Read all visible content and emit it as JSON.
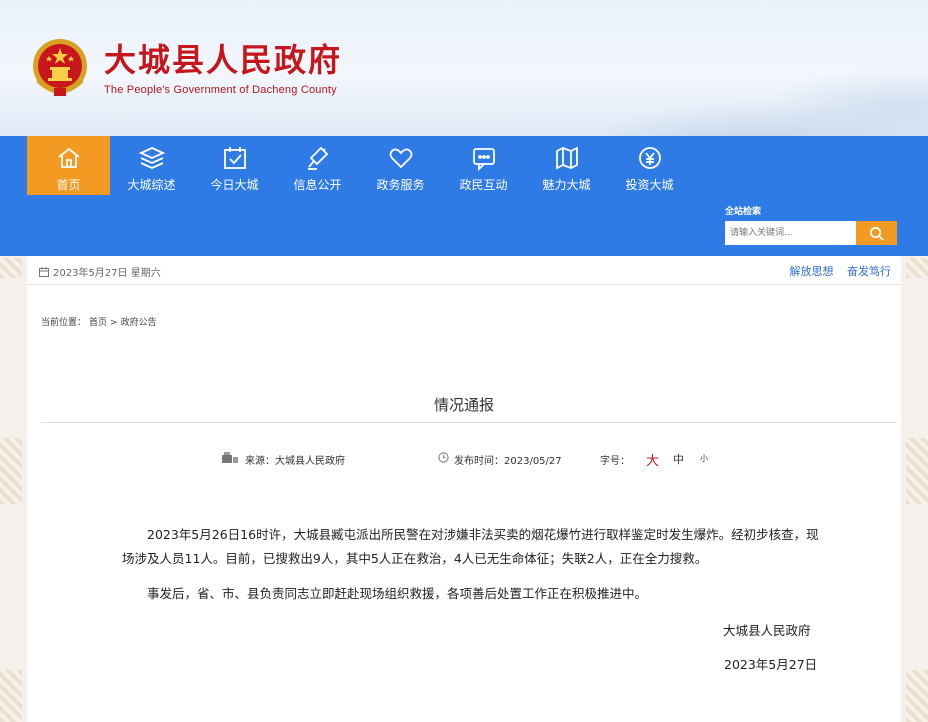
{
  "header": {
    "title": "大城县人民政府",
    "subtitle": "The People's Government of Dacheng County"
  },
  "nav": {
    "items": [
      {
        "label": "首页",
        "icon": "home-icon",
        "active": true
      },
      {
        "label": "大城综述",
        "icon": "layers-icon",
        "active": false
      },
      {
        "label": "今日大城",
        "icon": "calendar-check-icon",
        "active": false
      },
      {
        "label": "信息公开",
        "icon": "megaphone-icon",
        "active": false
      },
      {
        "label": "政务服务",
        "icon": "heart-icon",
        "active": false
      },
      {
        "label": "政民互动",
        "icon": "chat-icon",
        "active": false
      },
      {
        "label": "魅力大城",
        "icon": "map-icon",
        "active": false
      },
      {
        "label": "投资大城",
        "icon": "yuan-icon",
        "active": false
      }
    ],
    "active_color": "#f39a22",
    "bar_color": "#2f7be6"
  },
  "search": {
    "title": "全站检索",
    "placeholder": "请输入关键词..."
  },
  "topbar": {
    "date": "2023年5月27日 星期六",
    "links": [
      "解放思想",
      "奋发笃行"
    ]
  },
  "breadcrumb": {
    "prefix": "当前位置：",
    "home": "首页",
    "separator": ">",
    "current": "政府公告"
  },
  "article": {
    "title": "情况通报",
    "source_label": "来源：",
    "source": "大城县人民政府",
    "time_label": "发布时间：",
    "time": "2023/05/27",
    "fontsize_label": "字号：",
    "fontsize_large": "大",
    "fontsize_medium": "中",
    "fontsize_small": "小",
    "paragraphs": [
      "2023年5月26日16时许，大城县臧屯派出所民警在对涉嫌非法买卖的烟花爆竹进行取样鉴定时发生爆炸。经初步核查，现场涉及人员11人。目前，已搜救出9人，其中5人正在救治，4人已无生命体征；失联2人，正在全力搜救。",
      "事发后，省、市、县负责同志立即赶赴现场组织救援，各项善后处置工作正在积极推进中。"
    ],
    "signature": "大城县人民政府",
    "sign_date": "2023年5月27日"
  }
}
